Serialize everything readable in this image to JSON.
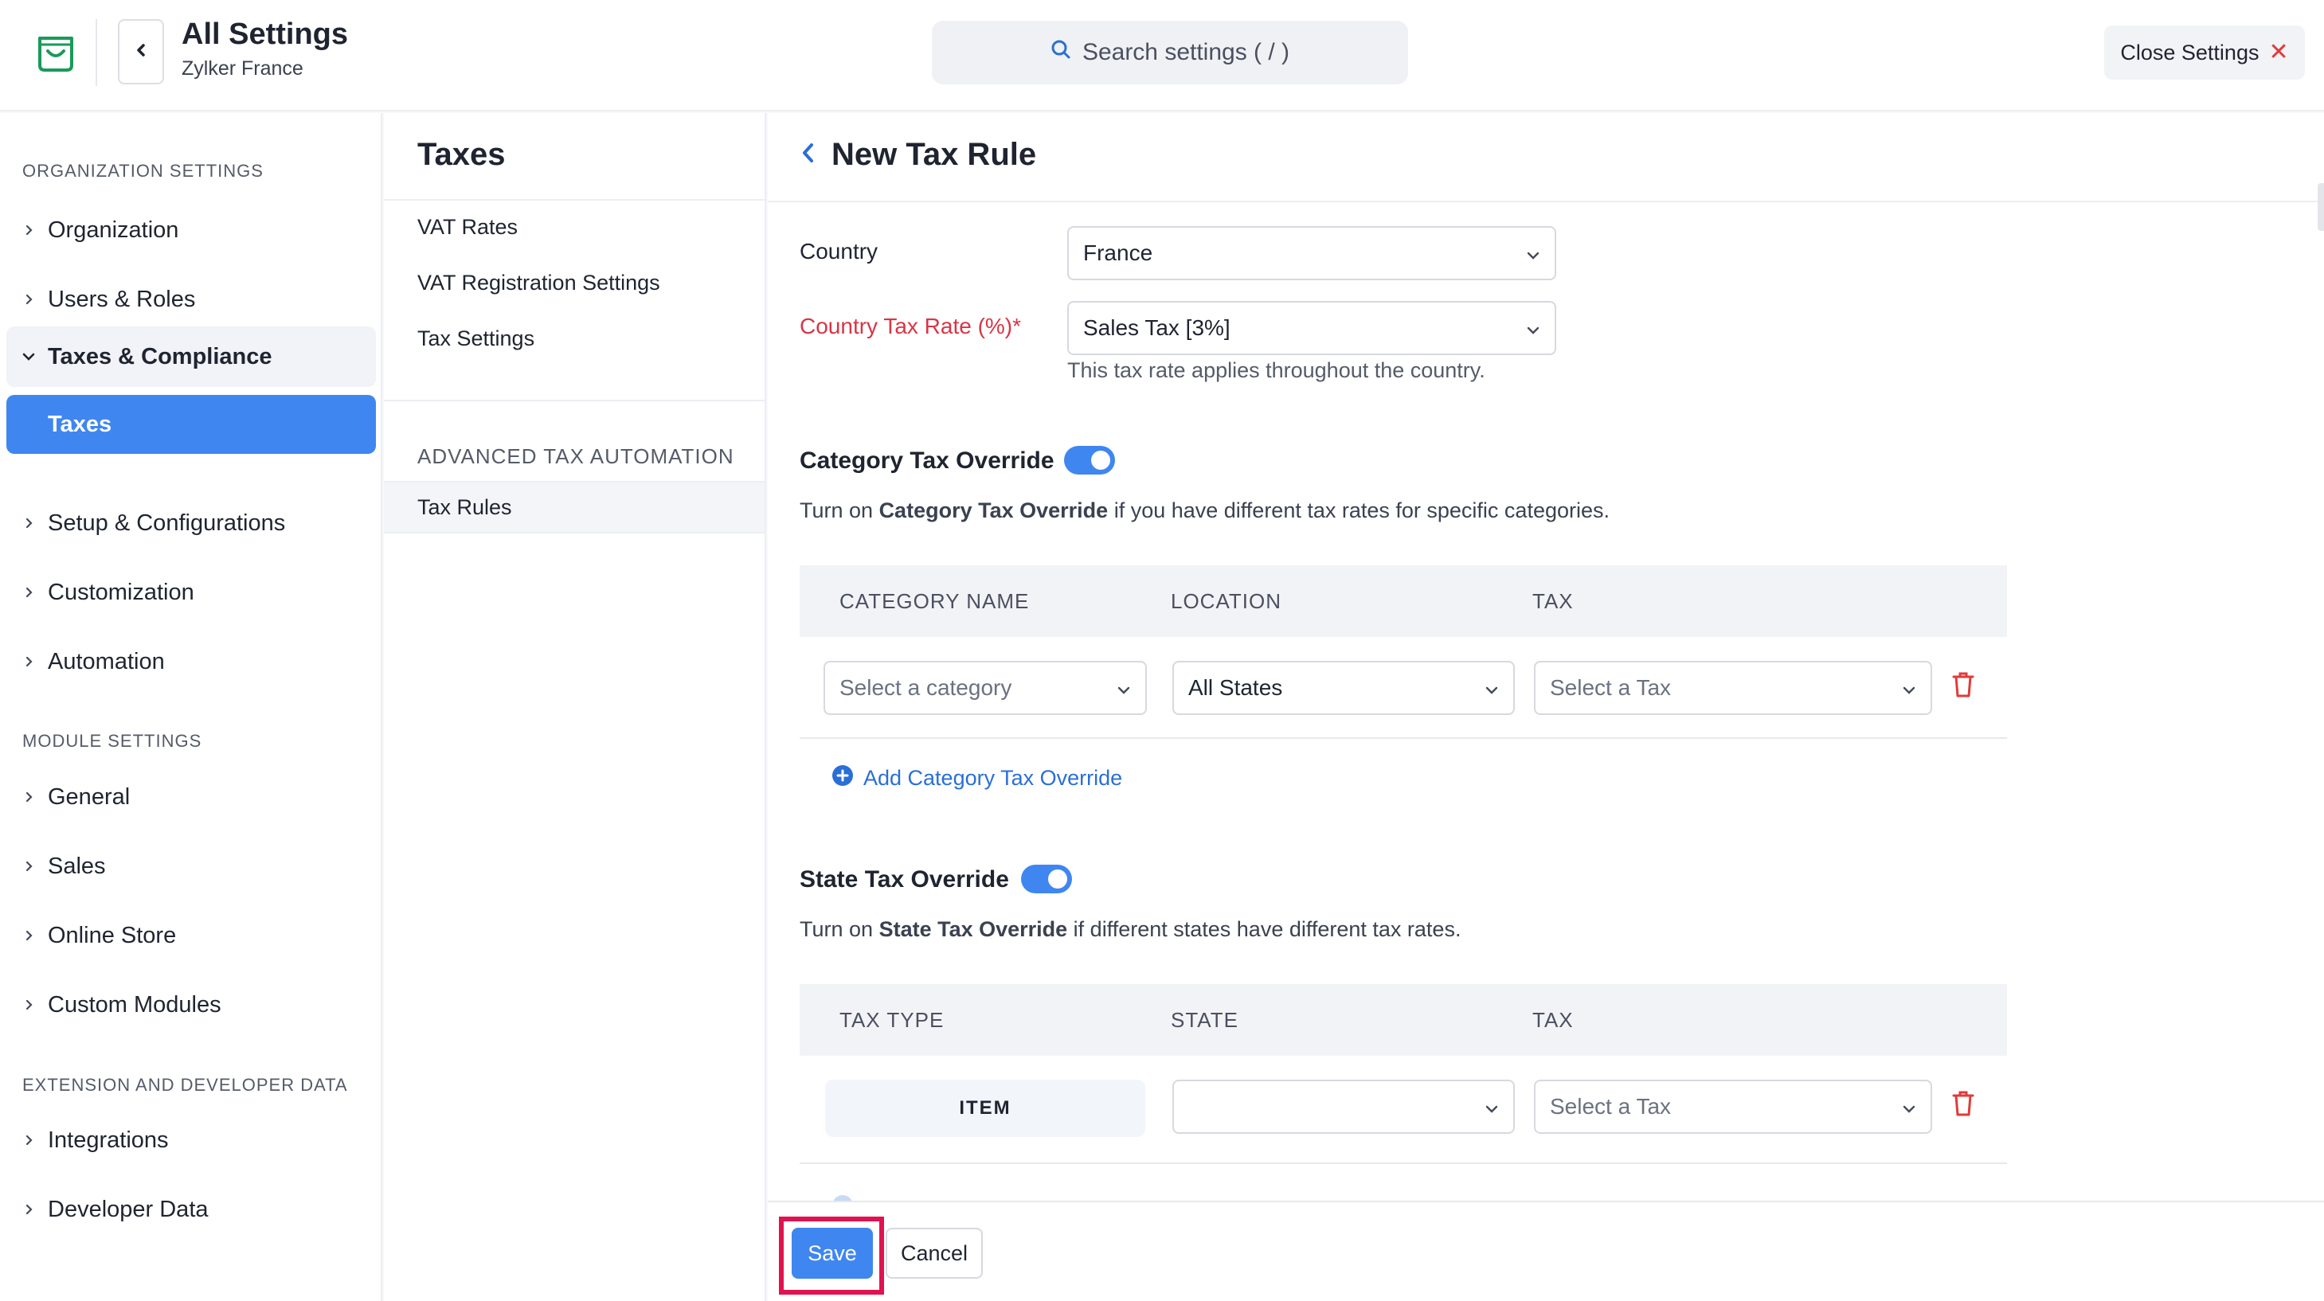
{
  "header": {
    "title": "All Settings",
    "subtitle": "Zylker France",
    "search_placeholder": "Search settings ( / )",
    "close_label": "Close Settings",
    "logo_icon": "shopping-bag-icon",
    "accent_color": "#3f86f0"
  },
  "sidebar": {
    "org_heading": "ORGANIZATION SETTINGS",
    "org_items": [
      {
        "label": "Organization"
      },
      {
        "label": "Users & Roles"
      },
      {
        "label": "Taxes & Compliance"
      },
      {
        "label": "Taxes"
      },
      {
        "label": "Setup & Configurations"
      },
      {
        "label": "Customization"
      },
      {
        "label": "Automation"
      }
    ],
    "module_heading": "MODULE SETTINGS",
    "module_items": [
      {
        "label": "General"
      },
      {
        "label": "Sales"
      },
      {
        "label": "Online Store"
      },
      {
        "label": "Custom Modules"
      }
    ],
    "ext_heading": "EXTENSION AND DEVELOPER DATA",
    "ext_items": [
      {
        "label": "Integrations"
      },
      {
        "label": "Developer Data"
      }
    ]
  },
  "midpanel": {
    "title": "Taxes",
    "links": [
      "VAT Rates",
      "VAT Registration Settings",
      "Tax Settings"
    ],
    "advanced_heading": "ADVANCED TAX AUTOMATION",
    "active_link": "Tax Rules"
  },
  "main": {
    "title": "New Tax Rule",
    "country_label": "Country",
    "country_value": "France",
    "rate_label": "Country Tax Rate (%)*",
    "rate_value": "Sales Tax [3%]",
    "rate_help": "This tax rate applies throughout the country.",
    "category": {
      "title": "Category Tax Override",
      "enabled": true,
      "desc_prefix": "Turn on ",
      "desc_bold": "Category Tax Override",
      "desc_suffix": " if you have different tax rates for specific categories.",
      "columns": [
        "CATEGORY NAME",
        "LOCATION",
        "TAX"
      ],
      "row": {
        "category_placeholder": "Select a category",
        "location_value": "All States",
        "tax_placeholder": "Select a Tax"
      },
      "add_label": "Add Category Tax Override"
    },
    "state": {
      "title": "State Tax Override",
      "enabled": true,
      "desc_prefix": "Turn on ",
      "desc_bold": "State Tax Override",
      "desc_suffix": " if different states have different tax rates.",
      "columns": [
        "TAX TYPE",
        "STATE",
        "TAX"
      ],
      "row": {
        "tax_type": "ITEM",
        "state_value": "",
        "tax_placeholder": "Select a Tax"
      }
    }
  },
  "footer": {
    "save_label": "Save",
    "cancel_label": "Cancel",
    "highlight_color": "#e0124f"
  }
}
